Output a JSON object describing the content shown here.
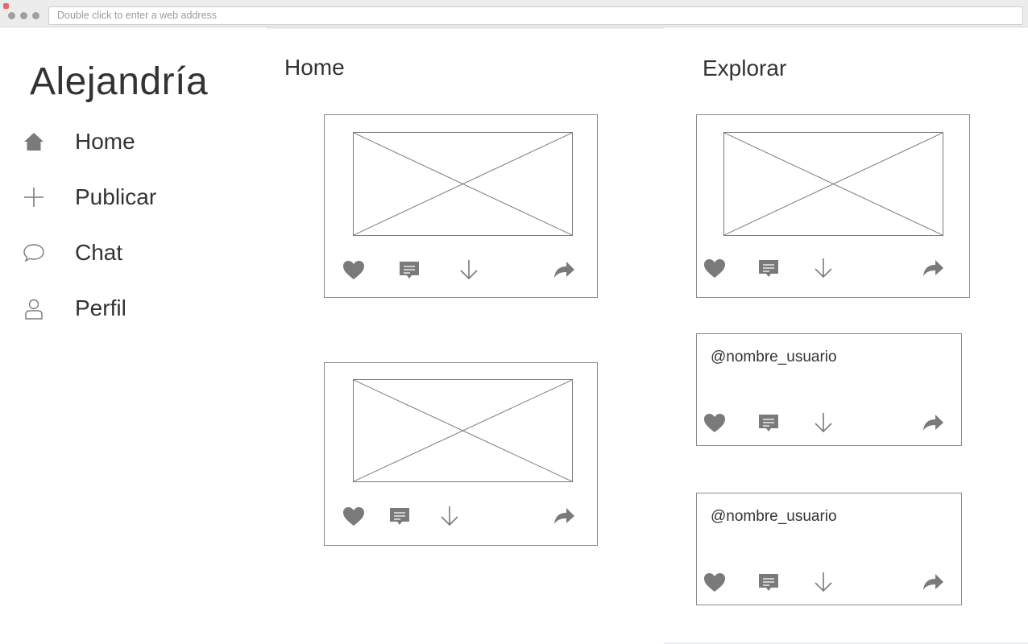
{
  "browser": {
    "address_placeholder": "Double click to enter a web address"
  },
  "app": {
    "brand": "Alejandría"
  },
  "sidebar": {
    "items": [
      {
        "label": "Home",
        "icon": "home-icon"
      },
      {
        "label": "Publicar",
        "icon": "plus-icon"
      },
      {
        "label": "Chat",
        "icon": "chat-bubble-icon"
      },
      {
        "label": "Perfil",
        "icon": "user-icon"
      }
    ]
  },
  "home": {
    "title": "Home",
    "posts": [
      {
        "type": "image",
        "actions": [
          "like",
          "comment",
          "download",
          "share"
        ]
      },
      {
        "type": "image",
        "actions": [
          "like",
          "comment",
          "download",
          "share"
        ]
      }
    ]
  },
  "explore": {
    "title": "Explorar",
    "posts": [
      {
        "type": "image",
        "actions": [
          "like",
          "comment",
          "download",
          "share"
        ]
      },
      {
        "type": "text",
        "username": "@nombre_usuario",
        "actions": [
          "like",
          "comment",
          "download",
          "share"
        ]
      },
      {
        "type": "text",
        "username": "@nombre_usuario",
        "actions": [
          "like",
          "comment",
          "download",
          "share"
        ]
      }
    ]
  },
  "colors": {
    "icon": "#7a7a7a",
    "border": "#8a8a8a",
    "text": "#333333",
    "chrome": "#ececec"
  }
}
